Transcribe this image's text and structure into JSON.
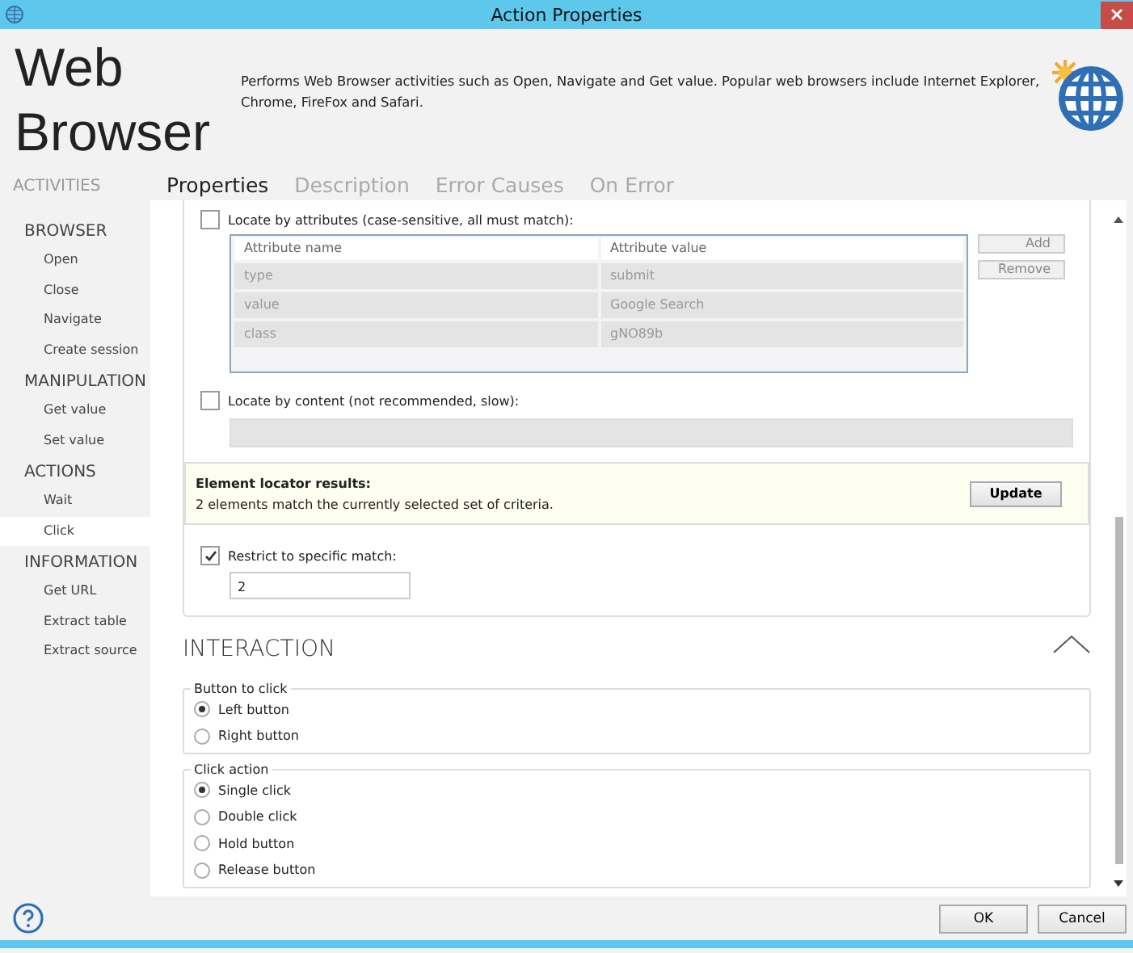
{
  "window": {
    "title": "Action Properties"
  },
  "header": {
    "title": "Web Browser",
    "description": "Performs Web Browser activities such as Open, Navigate and Get value. Popular web browsers include Internet Explorer, Chrome, FireFox and Safari."
  },
  "sidebar": {
    "heading": "ACTIVITIES",
    "groups": [
      {
        "title": "BROWSER",
        "items": [
          {
            "label": "Open",
            "selected": false
          },
          {
            "label": "Close",
            "selected": false
          },
          {
            "label": "Navigate",
            "selected": false
          },
          {
            "label": "Create session",
            "selected": false
          }
        ]
      },
      {
        "title": "MANIPULATION",
        "items": [
          {
            "label": "Get value",
            "selected": false
          },
          {
            "label": "Set value",
            "selected": false
          }
        ]
      },
      {
        "title": "ACTIONS",
        "items": [
          {
            "label": "Wait",
            "selected": false
          },
          {
            "label": "Click",
            "selected": true
          }
        ]
      },
      {
        "title": "INFORMATION",
        "items": [
          {
            "label": "Get URL",
            "selected": false
          },
          {
            "label": "Extract table",
            "selected": false
          },
          {
            "label": "Extract source",
            "selected": false
          }
        ]
      }
    ]
  },
  "tabs": [
    {
      "label": "Properties",
      "selected": true
    },
    {
      "label": "Description",
      "selected": false
    },
    {
      "label": "Error Causes",
      "selected": false
    },
    {
      "label": "On Error",
      "selected": false
    }
  ],
  "locator": {
    "by_attributes": {
      "label": "Locate by attributes (case-sensitive, all must match):",
      "checked": false,
      "columns": [
        "Attribute name",
        "Attribute value"
      ],
      "rows": [
        [
          "type",
          "submit"
        ],
        [
          "value",
          "Google Search"
        ],
        [
          "class",
          "gNO89b"
        ]
      ],
      "buttons": [
        "Add",
        "Remove"
      ]
    },
    "by_content": {
      "label": "Locate by content (not recommended, slow):",
      "checked": false
    },
    "results": {
      "title": "Element locator results:",
      "message": "2 elements match the currently selected set of criteria.",
      "button": "Update"
    },
    "restrict": {
      "label": "Restrict to specific match:",
      "checked": true,
      "value": "2"
    }
  },
  "interaction": {
    "title": "INTERACTION",
    "expanded": true,
    "groups": [
      {
        "title": "Button to click",
        "options": [
          {
            "label": "Left button",
            "selected": true
          },
          {
            "label": "Right button",
            "selected": false
          }
        ]
      },
      {
        "title": "Click action",
        "options": [
          {
            "label": "Single click",
            "selected": true
          },
          {
            "label": "Double click",
            "selected": false
          },
          {
            "label": "Hold button",
            "selected": false
          },
          {
            "label": "Release button",
            "selected": false
          }
        ]
      }
    ]
  },
  "footer": {
    "buttons": [
      "OK",
      "Cancel"
    ]
  }
}
